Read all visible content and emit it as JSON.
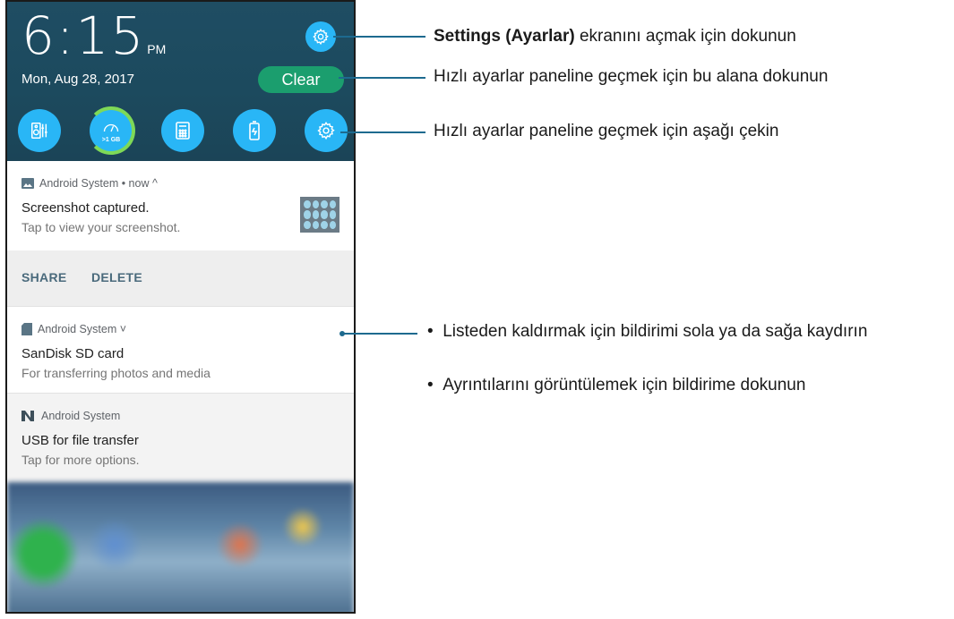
{
  "shade": {
    "time": "6:15",
    "ampm": "PM",
    "date": "Mon, Aug 28, 2017",
    "clear_label": "Clear",
    "quick_settings": [
      {
        "icon": "audio-wizard-icon"
      },
      {
        "icon": "boost-ram-icon",
        "label": ">1 GB"
      },
      {
        "icon": "calculator-icon"
      },
      {
        "icon": "battery-icon"
      },
      {
        "icon": "settings-icon"
      }
    ]
  },
  "notifications": [
    {
      "app": "Android System • now ^",
      "title": "Screenshot captured.",
      "text": "Tap to view your screenshot.",
      "actions": [
        "SHARE",
        "DELETE"
      ]
    },
    {
      "app": "Android System ˅",
      "title": "SanDisk SD card",
      "text": "For transferring photos and media"
    },
    {
      "app": "Android System",
      "title": "USB for file transfer",
      "text": "Tap for more options."
    }
  ],
  "callouts": {
    "settings_bold": "Settings (Ayarlar)",
    "settings_rest": " ekranını açmak için dokunun",
    "clear": "Hızlı ayarlar paneline geçmek için bu alana dokunun",
    "quick": "Hızlı ayarlar paneline geçmek için aşağı çekin",
    "swipe": "Listeden kaldırmak için bildirimi sola ya da sağa kaydırın",
    "tap": "Ayrıntılarını görüntülemek için bildirime dokunun"
  },
  "colors": {
    "accent": "#29b6f6",
    "clear_button": "#1b9e6e",
    "callout_line": "#1d6a8f"
  }
}
